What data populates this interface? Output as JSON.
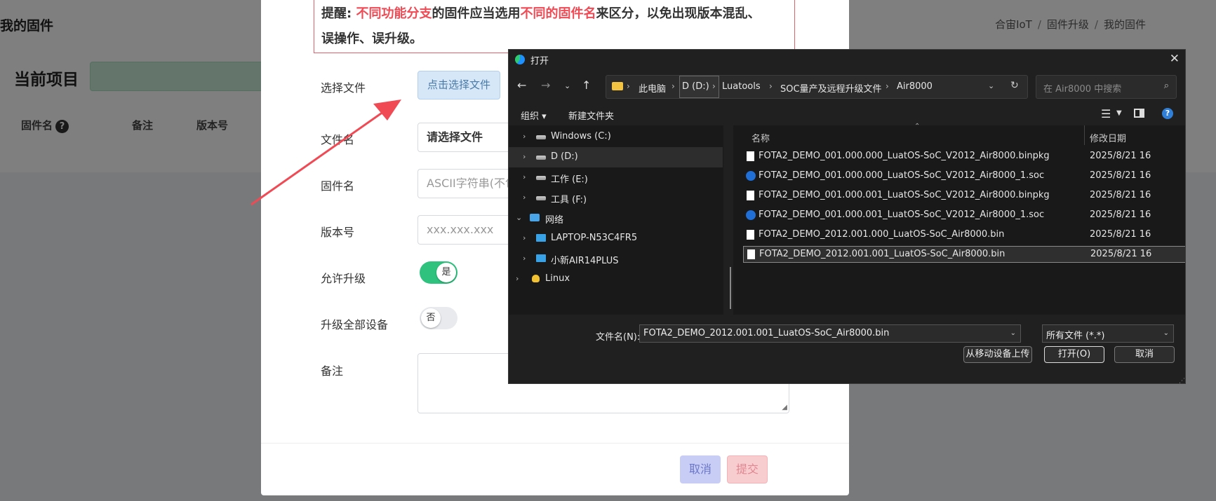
{
  "background": {
    "page_title": "我的固件",
    "breadcrumb": [
      "合宙IoT",
      "固件升级",
      "我的固件"
    ],
    "project_label": "当前项目",
    "columns": [
      "固件名",
      "备注",
      "版本号"
    ],
    "help_glyph": "?"
  },
  "modal": {
    "warning": {
      "prefix": "提醒: ",
      "red1": "不同功能分支",
      "mid1": "的固件应当选用",
      "red2": "不同的固件名",
      "suffix": "来区分，以免出现版本混乱、",
      "line2": "误操作、误升级。"
    },
    "labels": {
      "choose_file": "选择文件",
      "file_name": "文件名",
      "firmware_name": "固件名",
      "version": "版本号",
      "allow_upgrade": "允许升级",
      "upgrade_all": "升级全部设备",
      "remark": "备注"
    },
    "choose_file_button": "点击选择文件",
    "file_name_value": "请选择文件",
    "firmware_name_placeholder": "ASCII字符串(不包",
    "version_placeholder": "xxx.xxx.xxx",
    "allow_upgrade_toggle": "是",
    "upgrade_all_toggle": "否",
    "cancel_button": "取消",
    "submit_button": "提交"
  },
  "dialog": {
    "title": "打开",
    "close_glyph": "✕",
    "address": [
      "此电脑",
      "D (D:)",
      "Luatools",
      "SOC量产及远程升级文件",
      "Air8000"
    ],
    "search_placeholder": "在 Air8000 中搜索",
    "toolbar": {
      "organize": "组织 ▾",
      "new_folder": "新建文件夹"
    },
    "tree": [
      {
        "label": "Windows (C:)",
        "icon": "drive-icon"
      },
      {
        "label": "D (D:)",
        "icon": "drive-icon",
        "selected": true
      },
      {
        "label": "工作 (E:)",
        "icon": "drive-icon"
      },
      {
        "label": "工具 (F:)",
        "icon": "drive-icon"
      },
      {
        "label": "网络",
        "icon": "network-icon"
      },
      {
        "label": "LAPTOP-N53C4FR5",
        "icon": "computer-icon"
      },
      {
        "label": "小新AIR14PLUS",
        "icon": "computer-icon"
      },
      {
        "label": "Linux",
        "icon": "linux-icon"
      }
    ],
    "columns": {
      "name": "名称",
      "date": "修改日期"
    },
    "files": [
      {
        "name": "FOTA2_DEMO_001.000.000_LuatOS-SoC_V2012_Air8000.binpkg",
        "date": "2025/8/21 16",
        "icon": "file-icon"
      },
      {
        "name": "FOTA2_DEMO_001.000.000_LuatOS-SoC_V2012_Air8000_1.soc",
        "date": "2025/8/21 16",
        "icon": "soc-icon"
      },
      {
        "name": "FOTA2_DEMO_001.000.001_LuatOS-SoC_V2012_Air8000.binpkg",
        "date": "2025/8/21 16",
        "icon": "file-icon"
      },
      {
        "name": "FOTA2_DEMO_001.000.001_LuatOS-SoC_V2012_Air8000_1.soc",
        "date": "2025/8/21 16",
        "icon": "soc-icon"
      },
      {
        "name": "FOTA2_DEMO_2012.001.000_LuatOS-SoC_Air8000.bin",
        "date": "2025/8/21 16",
        "icon": "file-icon"
      },
      {
        "name": "FOTA2_DEMO_2012.001.001_LuatOS-SoC_Air8000.bin",
        "date": "2025/8/21 16",
        "icon": "file-icon",
        "selected": true
      }
    ],
    "filename_label": "文件名(N):",
    "filename_value": "FOTA2_DEMO_2012.001.001_LuatOS-SoC_Air8000.bin",
    "filetype": "所有文件 (*.*)",
    "buttons": {
      "mobile_upload": "从移动设备上传",
      "open": "打开(O)",
      "cancel": "取消"
    }
  },
  "colors": {
    "accent_red": "#f04a55",
    "toggle_on": "#2ec27e",
    "dialog_bg": "#202020"
  }
}
